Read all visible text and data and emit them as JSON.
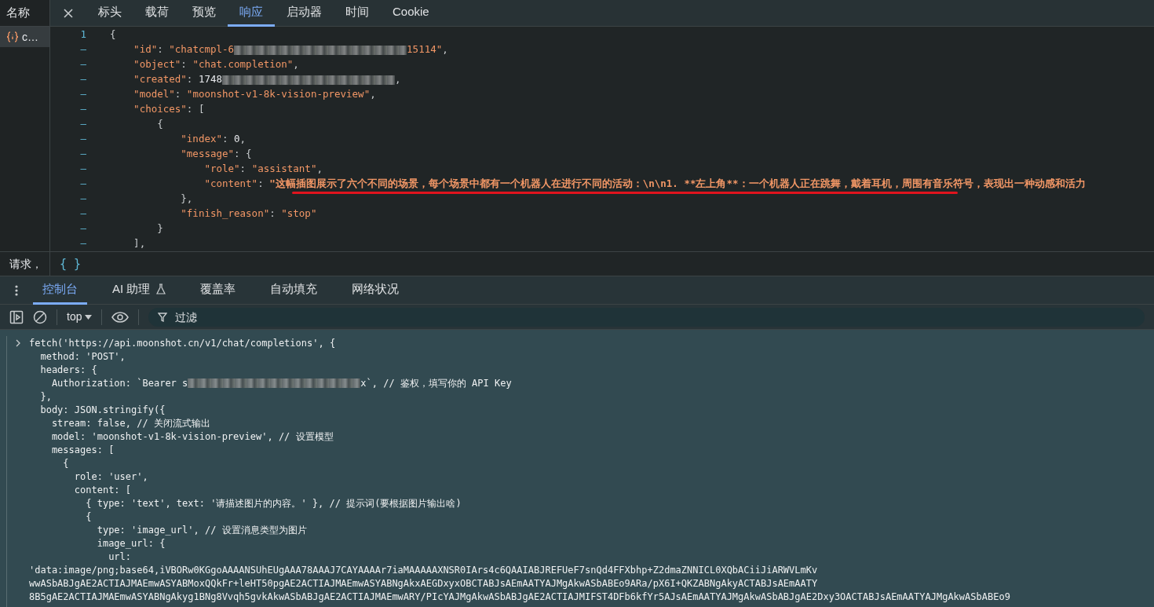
{
  "network_sidebar": {
    "header": "名称",
    "items": [
      {
        "name": "c…",
        "selected": true
      }
    ]
  },
  "detail_tabs": [
    {
      "label": "标头",
      "selected": false
    },
    {
      "label": "载荷",
      "selected": false
    },
    {
      "label": "预览",
      "selected": false
    },
    {
      "label": "响应",
      "selected": true
    },
    {
      "label": "启动器",
      "selected": false
    },
    {
      "label": "时间",
      "selected": false
    },
    {
      "label": "Cookie",
      "selected": false
    }
  ],
  "response": {
    "lines": [
      {
        "gutter": "1",
        "tokens": [
          {
            "kind": "punct",
            "text": "{"
          }
        ]
      },
      {
        "gutter": "–",
        "tokens": [
          {
            "kind": "key",
            "text": "    \"id\""
          },
          {
            "kind": "punct",
            "text": ": "
          },
          {
            "kind": "string",
            "text": "\"chatcmpl-6"
          },
          {
            "kind": "redacted"
          },
          {
            "kind": "string",
            "text": "15114\""
          },
          {
            "kind": "punct",
            "text": ","
          }
        ]
      },
      {
        "gutter": "–",
        "tokens": [
          {
            "kind": "key",
            "text": "    \"object\""
          },
          {
            "kind": "punct",
            "text": ": "
          },
          {
            "kind": "string",
            "text": "\"chat.completion\""
          },
          {
            "kind": "punct",
            "text": ","
          }
        ]
      },
      {
        "gutter": "–",
        "tokens": [
          {
            "kind": "key",
            "text": "    \"created\""
          },
          {
            "kind": "punct",
            "text": ": "
          },
          {
            "kind": "number",
            "text": "1748"
          },
          {
            "kind": "redacted"
          },
          {
            "kind": "punct",
            "text": ","
          }
        ]
      },
      {
        "gutter": "–",
        "tokens": [
          {
            "kind": "key",
            "text": "    \"model\""
          },
          {
            "kind": "punct",
            "text": ": "
          },
          {
            "kind": "string",
            "text": "\"moonshot-v1-8k-vision-preview\""
          },
          {
            "kind": "punct",
            "text": ","
          }
        ]
      },
      {
        "gutter": "–",
        "tokens": [
          {
            "kind": "key",
            "text": "    \"choices\""
          },
          {
            "kind": "punct",
            "text": ": ["
          }
        ]
      },
      {
        "gutter": "–",
        "tokens": [
          {
            "kind": "punct",
            "text": "        {"
          }
        ]
      },
      {
        "gutter": "–",
        "tokens": [
          {
            "kind": "key",
            "text": "            \"index\""
          },
          {
            "kind": "punct",
            "text": ": "
          },
          {
            "kind": "number",
            "text": "0"
          },
          {
            "kind": "punct",
            "text": ","
          }
        ]
      },
      {
        "gutter": "–",
        "tokens": [
          {
            "kind": "key",
            "text": "            \"message\""
          },
          {
            "kind": "punct",
            "text": ": {"
          }
        ]
      },
      {
        "gutter": "–",
        "tokens": [
          {
            "kind": "key",
            "text": "                \"role\""
          },
          {
            "kind": "punct",
            "text": ": "
          },
          {
            "kind": "string",
            "text": "\"assistant\""
          },
          {
            "kind": "punct",
            "text": ","
          }
        ]
      },
      {
        "gutter": "–",
        "tokens": [
          {
            "kind": "key",
            "text": "                \"content\""
          },
          {
            "kind": "punct",
            "text": ": "
          },
          {
            "kind": "highlighted",
            "text": "\"这幅插图展示了六个不同的场景，每个场景中都有一个机器人在进行不同的活动：\\n\\n1. **左上角**：一个机器人正在跳舞，戴着耳机，周围有音乐符号，表现出一种动感和活力"
          }
        ]
      },
      {
        "gutter": "–",
        "tokens": [
          {
            "kind": "punct",
            "text": "            },"
          }
        ]
      },
      {
        "gutter": "–",
        "tokens": [
          {
            "kind": "key",
            "text": "            \"finish_reason\""
          },
          {
            "kind": "punct",
            "text": ": "
          },
          {
            "kind": "string",
            "text": "\"stop\""
          }
        ]
      },
      {
        "gutter": "–",
        "tokens": [
          {
            "kind": "punct",
            "text": "        }"
          }
        ]
      },
      {
        "gutter": "–",
        "tokens": [
          {
            "kind": "punct",
            "text": "    ],"
          }
        ]
      }
    ]
  },
  "status_row": {
    "text": "请求，",
    "pretty_print": "{ }"
  },
  "drawer_tabs": [
    {
      "label": "控制台",
      "selected": true,
      "kind": "plain"
    },
    {
      "label": "AI 助理",
      "selected": false,
      "kind": "experimental"
    },
    {
      "label": "覆盖率",
      "selected": false,
      "kind": "plain"
    },
    {
      "label": "自动填充",
      "selected": false,
      "kind": "plain"
    },
    {
      "label": "网络状况",
      "selected": false,
      "kind": "plain"
    }
  ],
  "console_toolbar": {
    "context": "top",
    "filter": {
      "placeholder": "过滤"
    }
  },
  "console": {
    "lines": [
      {
        "prompt": true,
        "tokens": [
          {
            "kind": "code",
            "text": "fetch('https://api.moonshot.cn/v1/chat/completions', {"
          }
        ]
      },
      {
        "prompt": false,
        "tokens": [
          {
            "kind": "code",
            "text": "  method: 'POST',"
          }
        ]
      },
      {
        "prompt": false,
        "tokens": [
          {
            "kind": "code",
            "text": "  headers: {"
          }
        ]
      },
      {
        "prompt": false,
        "tokens": [
          {
            "kind": "code",
            "text": "    Authorization: `Bearer s"
          },
          {
            "kind": "redacted"
          },
          {
            "kind": "code",
            "text": "x`, // 鉴权，填写你的 API Key"
          }
        ]
      },
      {
        "prompt": false,
        "tokens": [
          {
            "kind": "code",
            "text": "  },"
          }
        ]
      },
      {
        "prompt": false,
        "tokens": [
          {
            "kind": "code",
            "text": "  body: JSON.stringify({"
          }
        ]
      },
      {
        "prompt": false,
        "tokens": [
          {
            "kind": "code",
            "text": "    stream: false, // 关闭流式输出"
          }
        ]
      },
      {
        "prompt": false,
        "tokens": [
          {
            "kind": "code",
            "text": "    model: 'moonshot-v1-8k-vision-preview', // 设置模型"
          }
        ]
      },
      {
        "prompt": false,
        "tokens": [
          {
            "kind": "code",
            "text": "    messages: ["
          }
        ]
      },
      {
        "prompt": false,
        "tokens": [
          {
            "kind": "code",
            "text": "      {"
          }
        ]
      },
      {
        "prompt": false,
        "tokens": [
          {
            "kind": "code",
            "text": "        role: 'user',"
          }
        ]
      },
      {
        "prompt": false,
        "tokens": [
          {
            "kind": "code",
            "text": "        content: ["
          }
        ]
      },
      {
        "prompt": false,
        "tokens": [
          {
            "kind": "code",
            "text": "          { type: 'text', text: '请描述图片的内容。' }, // 提示词(要根据图片输出啥)"
          }
        ]
      },
      {
        "prompt": false,
        "tokens": [
          {
            "kind": "code",
            "text": "          {"
          }
        ]
      },
      {
        "prompt": false,
        "tokens": [
          {
            "kind": "code",
            "text": "            type: 'image_url', // 设置消息类型为图片"
          }
        ]
      },
      {
        "prompt": false,
        "tokens": [
          {
            "kind": "code",
            "text": "            image_url: {"
          }
        ]
      },
      {
        "prompt": false,
        "tokens": [
          {
            "kind": "code",
            "text": "              url:"
          }
        ]
      },
      {
        "prompt": false,
        "tokens": [
          {
            "kind": "code",
            "text": "'data:image/png;base64,iVBORw0KGgoAAAANSUhEUgAAA78AAAJ7CAYAAAAr7iaMAAAAAXNSR0IArs4c6QAAIABJREFUeF7snQd4FFXbhp+Z2dmaZNNICL0XQbACiiJiARWVLmKv"
          }
        ]
      },
      {
        "prompt": false,
        "tokens": [
          {
            "kind": "code",
            "text": "wwASbABJgAE2ACTIAJMAEmwASYABMoxQQkFr+leHT50pgAE2ACTIAJMAEmwASYABNgAkxAEGDxyxOBCTABJsAEmAATYAJMgAkwASbABEo9ARa/pX6I+QKZABNgAkyACTABJsAEmAATY"
          }
        ]
      },
      {
        "prompt": false,
        "tokens": [
          {
            "kind": "code",
            "text": "8B5gAE2ACTIAJMAEmwASYABNgAkyg1BNg8Vvqh5gvkAkwASbABJgAE2ACTIAJMAEmwARY/PIcYAJMgAkwASbABJgAE2ACTIAJMIFST4DFb6kfYr5AJsAEmAATYAJMgAkwASbABJgAE2Dxy3OACTABJsAEmAATYAJMgAkwASbABEo9"
          }
        ]
      }
    ]
  }
}
